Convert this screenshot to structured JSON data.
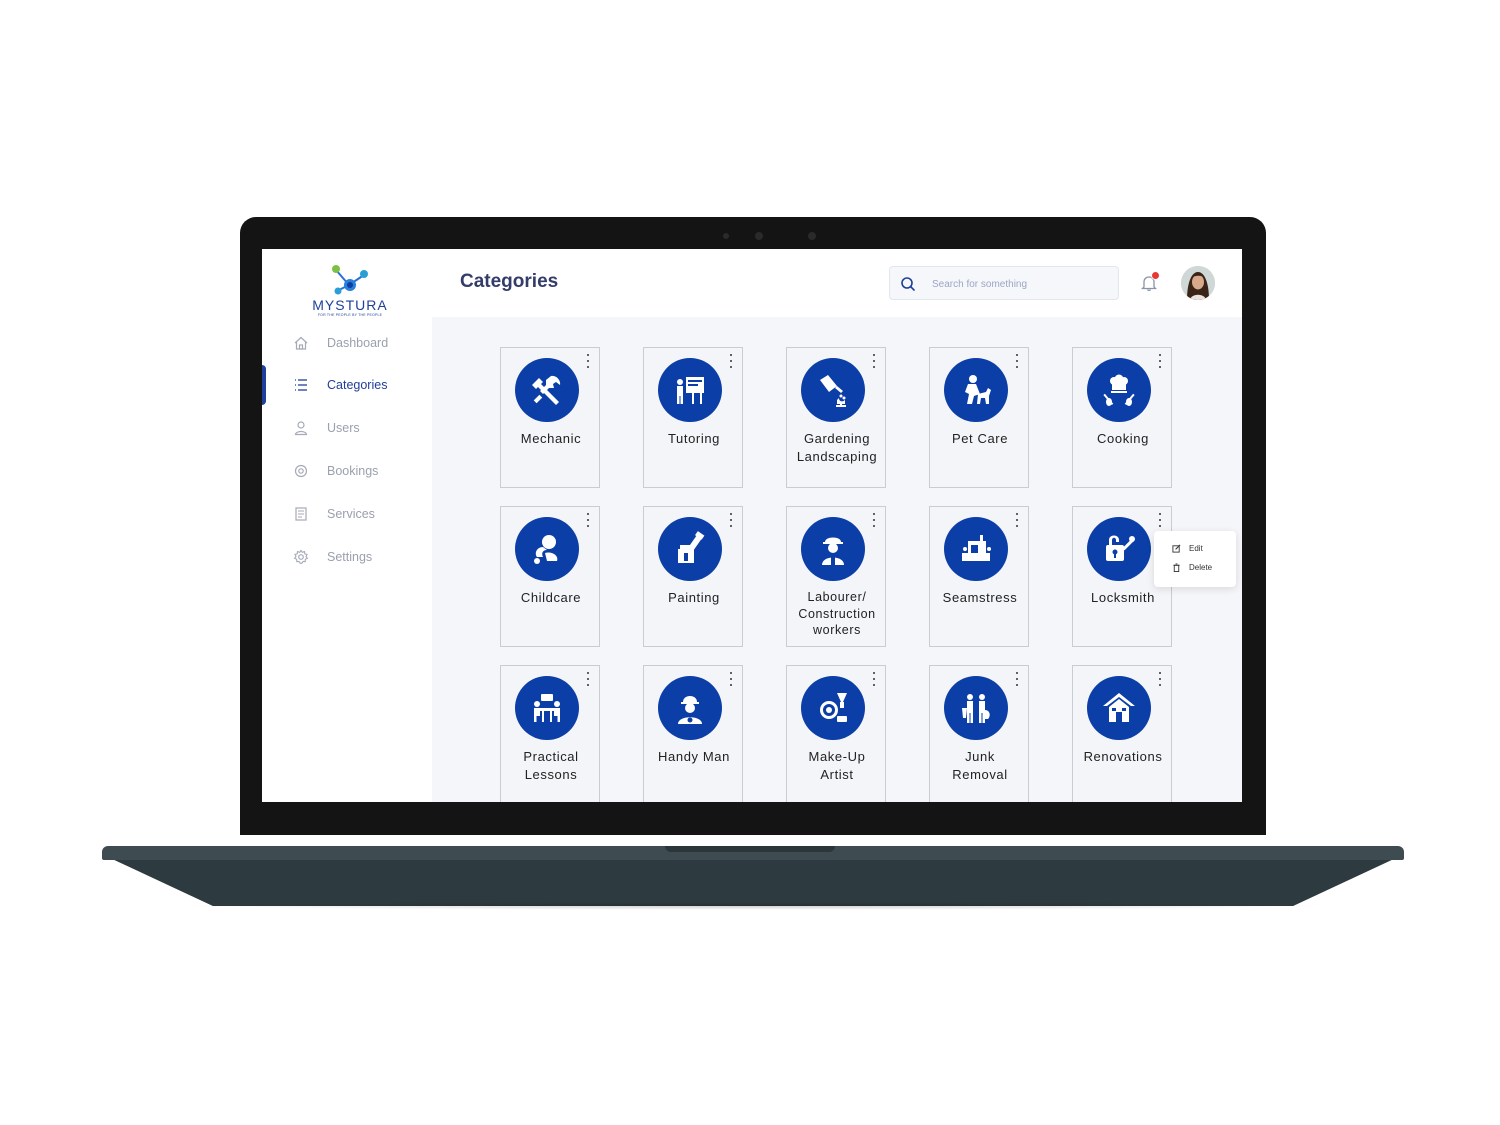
{
  "app": {
    "logo_text": "MYSTURA",
    "logo_tagline": "FOR THE PEOPLE BY THE PEOPLE"
  },
  "sidebar": {
    "items": [
      {
        "label": "Dashboard",
        "icon": "home-icon",
        "active": false
      },
      {
        "label": "Categories",
        "icon": "list-icon",
        "active": true
      },
      {
        "label": "Users",
        "icon": "user-icon",
        "active": false
      },
      {
        "label": "Bookings",
        "icon": "bookings-icon",
        "active": false
      },
      {
        "label": "Services",
        "icon": "services-icon",
        "active": false
      },
      {
        "label": "Settings",
        "icon": "gear-icon",
        "active": false
      }
    ]
  },
  "header": {
    "title": "Categories",
    "search_placeholder": "Search for something",
    "notification_icon": "bell-icon",
    "avatar_icon": "user-avatar"
  },
  "categories": [
    {
      "label": "Mechanic",
      "icon": "wrench-screwdriver-icon"
    },
    {
      "label": "Tutoring",
      "icon": "teacher-board-icon"
    },
    {
      "label": "Gardening\nLandscaping",
      "icon": "watering-can-icon"
    },
    {
      "label": "Pet Care",
      "icon": "person-dog-icon"
    },
    {
      "label": "Cooking",
      "icon": "chef-hat-utensils-icon"
    },
    {
      "label": "Childcare",
      "icon": "baby-icon"
    },
    {
      "label": "Painting",
      "icon": "paint-roller-icon"
    },
    {
      "label": "Labourer/\nConstruction\nworkers",
      "icon": "construction-worker-icon"
    },
    {
      "label": "Seamstress",
      "icon": "sewing-machine-icon"
    },
    {
      "label": "Locksmith",
      "icon": "lock-key-icon"
    },
    {
      "label": "Practical\nLessons",
      "icon": "meeting-table-icon"
    },
    {
      "label": "Handy Man",
      "icon": "handyman-icon"
    },
    {
      "label": "Make-Up\nArtist",
      "icon": "makeup-mirror-icon"
    },
    {
      "label": "Junk\nRemoval",
      "icon": "people-trash-icon"
    },
    {
      "label": "Renovations",
      "icon": "house-icon"
    }
  ],
  "context_menu": {
    "edit_label": "Edit",
    "delete_label": "Delete"
  },
  "colors": {
    "accent": "#1f3f9a",
    "icon_circle": "#0b3ea7",
    "title": "#343c6a",
    "badge": "#e53935"
  }
}
